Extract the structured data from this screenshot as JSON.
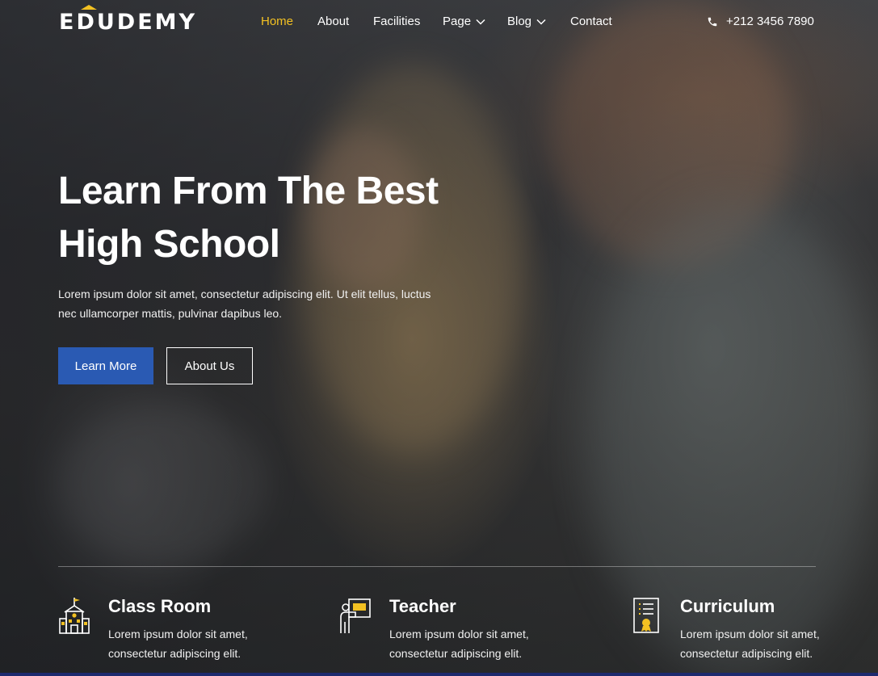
{
  "brand": {
    "logo_text": "EDUDEMY",
    "accent_color": "#f3c122",
    "primary_color": "#2a5ab3"
  },
  "nav": {
    "items": [
      {
        "label": "Home",
        "active": true
      },
      {
        "label": "About"
      },
      {
        "label": "Facilities"
      },
      {
        "label": "Page",
        "dropdown": true
      },
      {
        "label": "Blog",
        "dropdown": true
      },
      {
        "label": "Contact"
      }
    ],
    "phone": "+212 3456 7890",
    "phone_icon": "phone-icon"
  },
  "hero": {
    "title_line1": "Learn From The Best",
    "title_line2": "High School",
    "description": "Lorem ipsum dolor sit amet, consectetur adipiscing elit. Ut elit tellus, luctus nec ullamcorper mattis, pulvinar dapibus leo.",
    "primary_button": "Learn More",
    "secondary_button": "About Us"
  },
  "features": [
    {
      "icon": "school-building-icon",
      "title": "Class Room",
      "description": "Lorem ipsum dolor sit amet, consectetur adipiscing elit."
    },
    {
      "icon": "teacher-board-icon",
      "title": "Teacher",
      "description": "Lorem ipsum dolor sit amet, consectetur adipiscing elit."
    },
    {
      "icon": "certificate-icon",
      "title": "Curriculum",
      "description": "Lorem ipsum dolor sit amet, consectetur adipiscing elit."
    }
  ]
}
